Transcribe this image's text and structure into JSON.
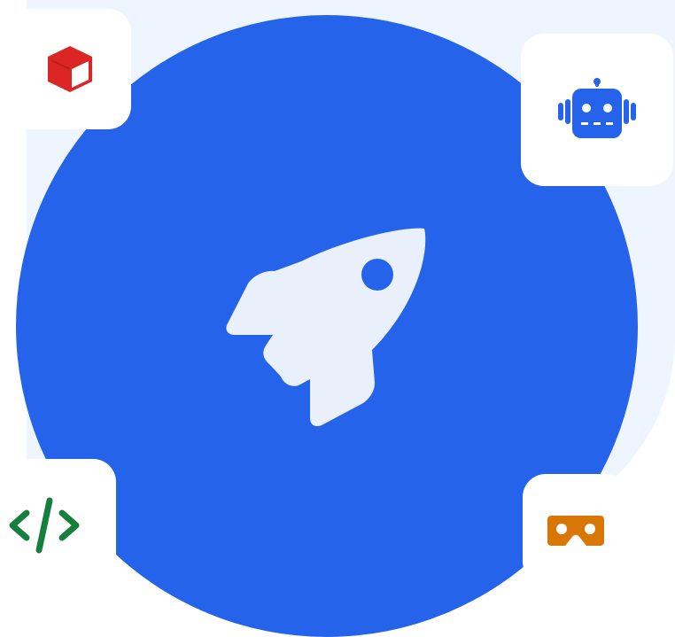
{
  "colors": {
    "background_panel": "#eff5fe",
    "hero_circle": "#2563eb",
    "rocket": "#eaf0fb",
    "card": "#ffffff",
    "cube_icon": "#dc2626",
    "robot_icon": "#2563eb",
    "code_icon": "#15803d",
    "vr_icon": "#d97706"
  },
  "icons": {
    "hero": "rocket-icon",
    "top_left": "cube-icon",
    "top_right": "robot-icon",
    "bottom_left": "code-icon",
    "bottom_right": "vr-headset-icon"
  }
}
